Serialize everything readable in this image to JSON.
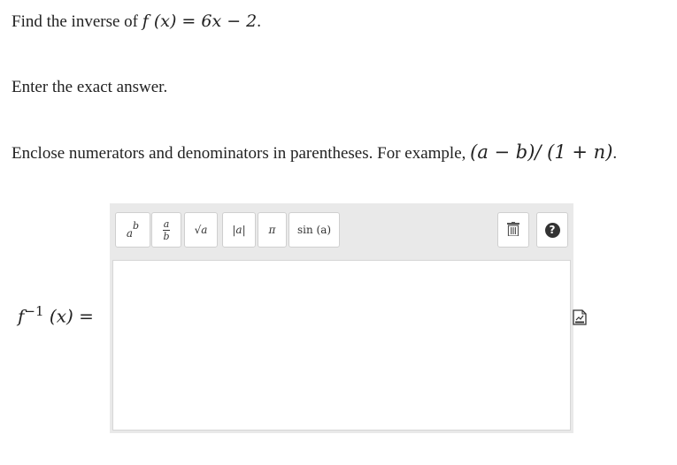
{
  "question": {
    "prompt_text": "Find the inverse of ",
    "function_expr": "f (x) = 6x − 2",
    "prompt_end": "."
  },
  "instruction": "Enter the exact answer.",
  "hint": {
    "text": "Enclose numerators and denominators in parentheses. For example, ",
    "example": "(a − b)/ (1 + n)",
    "end": "."
  },
  "answer": {
    "lhs": "f",
    "lhs_sup": "−1",
    "lhs_rest": " (x) =",
    "value": ""
  },
  "toolbar": {
    "power_base": "a",
    "power_exp": "b",
    "frac_num": "a",
    "frac_den": "b",
    "sqrt_label": "√a",
    "abs_label": "|a|",
    "pi_label": "π",
    "sin_label": "sin (a)",
    "help_label": "?"
  },
  "icons": {
    "trash": "trash-icon",
    "help": "help-icon",
    "submit": "submit-answer-icon"
  }
}
